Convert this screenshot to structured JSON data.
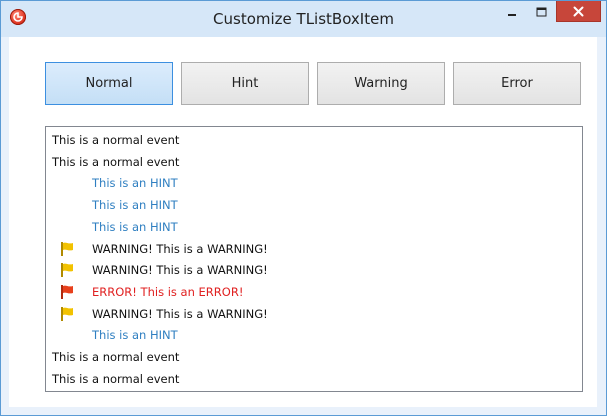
{
  "window": {
    "title": "Customize TListBoxItem"
  },
  "buttons": [
    {
      "label": "Normal",
      "active": true
    },
    {
      "label": "Hint",
      "active": false
    },
    {
      "label": "Warning",
      "active": false
    },
    {
      "label": "Error",
      "active": false
    }
  ],
  "colors": {
    "hint_text": "#2f7fc1",
    "error_text": "#e02020",
    "warning_flag": "#f2c200",
    "error_flag": "#e8401c",
    "active_button": "#c4dff6"
  },
  "list": {
    "items": [
      {
        "type": "normal",
        "text": "This is a normal event"
      },
      {
        "type": "normal",
        "text": "This is a normal event"
      },
      {
        "type": "hint",
        "text": "This is an HINT"
      },
      {
        "type": "hint",
        "text": "This is an HINT"
      },
      {
        "type": "hint",
        "text": "This is an HINT"
      },
      {
        "type": "warning",
        "text": "WARNING! This is a WARNING!",
        "icon": "yellow-flag-icon"
      },
      {
        "type": "warning",
        "text": "WARNING! This is a WARNING!",
        "icon": "yellow-flag-icon"
      },
      {
        "type": "error",
        "text": "ERROR! This is an ERROR!",
        "icon": "red-flag-icon"
      },
      {
        "type": "warning",
        "text": "WARNING! This is a WARNING!",
        "icon": "yellow-flag-icon"
      },
      {
        "type": "hint",
        "text": "This is an HINT"
      },
      {
        "type": "normal",
        "text": "This is a normal event"
      },
      {
        "type": "normal",
        "text": "This is a normal event"
      }
    ]
  }
}
